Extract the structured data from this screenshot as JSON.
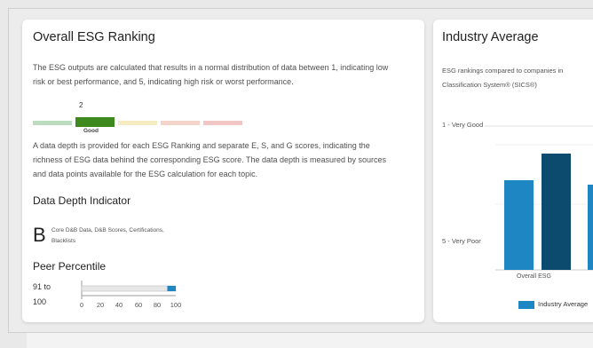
{
  "esg_card": {
    "title": "Overall ESG Ranking",
    "intro_line1": "The ESG outputs are calculated that results in a normal distribution of data between 1, indicating low",
    "intro_line2": "risk or best performance, and 5, indicating high risk or worst performance.",
    "ranking": {
      "value": "2",
      "label": "Good",
      "segments": [
        {
          "rank": 1,
          "color": "#bcdcbf"
        },
        {
          "rank": 2,
          "color": "#3e8a1e"
        },
        {
          "rank": 3,
          "color": "#f6ecc2"
        },
        {
          "rank": 4,
          "color": "#f4d3c8"
        },
        {
          "rank": 5,
          "color": "#f1c6c4"
        }
      ]
    },
    "depth_line1": "A data depth is provided for each ESG Ranking and separate E, S, and G scores, indicating the",
    "depth_line2": "richness of ESG data behind the corresponding ESG score. The data depth is measured by sources",
    "depth_line3": "and data points available for the ESG calculation for each topic.",
    "depth_title": "Data Depth Indicator",
    "depth_grade": "B",
    "depth_desc_line1": "Core D&B Data, D&B Scores, Certifications,",
    "depth_desc_line2": "Blacklists",
    "peer_title": "Peer Percentile",
    "peer_label_line1": "91 to",
    "peer_label_line2": "100",
    "peer_range": [
      91,
      100
    ],
    "peer_ticks": [
      "0",
      "20",
      "40",
      "60",
      "80",
      "100"
    ],
    "peer_color": "#1f86c4"
  },
  "industry_card": {
    "title": "Industry Average",
    "desc_line1": "ESG rankings compared to companies in",
    "desc_line2": "Classification System® (SICS®)",
    "axis_top": "1 - Very Good",
    "axis_bottom": "5 - Very Poor",
    "category_first": "Overall ESG",
    "legend_label": "Industry Average",
    "colors": {
      "industry": "#1f86c4",
      "company": "#0c4a6e"
    }
  }
}
